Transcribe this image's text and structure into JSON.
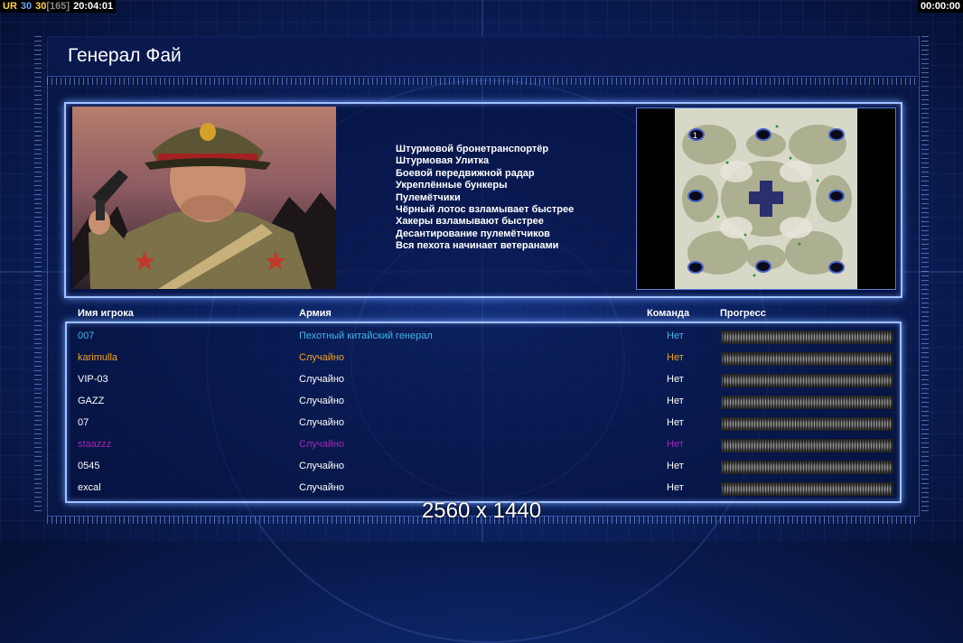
{
  "topbar": {
    "prefix": "UR",
    "val1": "30",
    "val2": "30",
    "bracket": "[165]",
    "time": "20:04:01",
    "right_time": "00:00:00"
  },
  "title": "Генерал Фай",
  "features": [
    "Штурмовой бронетранспортёр",
    "Штурмовая Улитка",
    "Боевой передвижной радар",
    "Укреплённые бункеры",
    "Пулемётчики",
    "Чёрный лотос взламывает быстрее",
    "Хакеры взламывают быстрее",
    "Десантирование пулемётчиков",
    "Вся пехота начинает ветеранами"
  ],
  "minimap": {
    "start_label": "1"
  },
  "table": {
    "headers": {
      "name": "Имя игрока",
      "army": "Армия",
      "team": "Команда",
      "progress": "Прогресс"
    },
    "rows": [
      {
        "name": "007",
        "army": "Пехотный китайский генерал",
        "team": "Нет",
        "color": "#3fb6e8"
      },
      {
        "name": "karimulla",
        "army": "Случайно",
        "team": "Нет",
        "color": "#f2a31b"
      },
      {
        "name": "VIP-03",
        "army": "Случайно",
        "team": "Нет",
        "color": "#ffffff"
      },
      {
        "name": "GAZZ",
        "army": "Случайно",
        "team": "Нет",
        "color": "#ffffff"
      },
      {
        "name": "07",
        "army": "Случайно",
        "team": "Нет",
        "color": "#ffffff"
      },
      {
        "name": "staazzz",
        "army": "Случайно",
        "team": "Нет",
        "color": "#a323b8"
      },
      {
        "name": "0545",
        "army": "Случайно",
        "team": "Нет",
        "color": "#ffffff"
      },
      {
        "name": "excal",
        "army": "Случайно",
        "team": "Нет",
        "color": "#ffffff"
      }
    ]
  },
  "resolution": "2560 x 1440",
  "colors": {
    "panel_border": "#9fc0ff",
    "accent_orange": "#f2a31b",
    "accent_yellow": "#ffd24a",
    "accent_blue": "#3fb6e8"
  }
}
